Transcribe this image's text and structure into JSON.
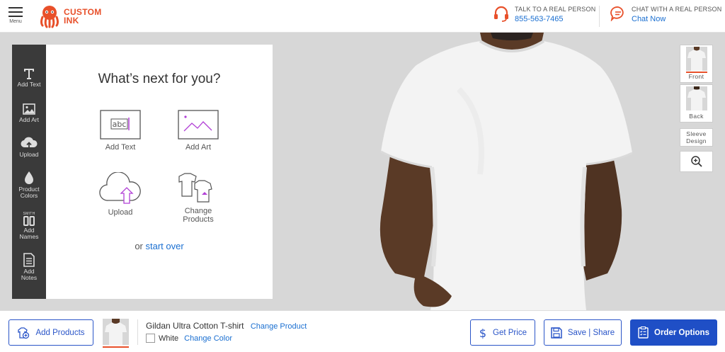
{
  "header": {
    "menu_label": "Menu",
    "logo_line1": "CUSTOM",
    "logo_line2": "INK",
    "phone": {
      "label": "TALK TO A REAL PERSON",
      "number": "855-563-7465",
      "icon": "headset-icon"
    },
    "chat": {
      "label": "CHAT WITH A REAL PERSON",
      "link": "Chat Now",
      "icon": "chat-bubble-icon"
    }
  },
  "toolbar": {
    "items": [
      {
        "label": "Add Text",
        "icon": "text-icon"
      },
      {
        "label": "Add Art",
        "icon": "image-icon"
      },
      {
        "label": "Upload",
        "icon": "cloud-upload-icon"
      },
      {
        "label_line1": "Product",
        "label_line2": "Colors",
        "icon": "droplet-icon"
      },
      {
        "label_line1": "Add",
        "label_line2": "Names",
        "icon": "names-icon",
        "icon_text": "SMITH"
      },
      {
        "label_line1": "Add",
        "label_line2": "Notes",
        "icon": "notes-icon"
      }
    ]
  },
  "panel": {
    "title": "What’s next for you?",
    "options": [
      {
        "label": "Add Text",
        "icon": "add-text-icon",
        "icon_text": "abc"
      },
      {
        "label": "Add Art",
        "icon": "add-art-icon"
      },
      {
        "label": "Upload",
        "icon": "upload-cloud-icon"
      },
      {
        "label_line1": "Change",
        "label_line2": "Products",
        "icon": "change-products-icon"
      }
    ],
    "start_over_prefix": "or",
    "start_over_link": "start over"
  },
  "views": {
    "front": "Front",
    "back": "Back",
    "sleeve_line1": "Sleeve",
    "sleeve_line2": "Design",
    "selected": "Front",
    "zoom_icon": "zoom-in-icon"
  },
  "bottom": {
    "add_products": "Add Products",
    "product_name": "Gildan Ultra Cotton T-shirt",
    "change_product": "Change Product",
    "color_name": "White",
    "change_color": "Change Color",
    "get_price": "Get Price",
    "save_share": "Save | Share",
    "order_options": "Order Options"
  },
  "colors": {
    "brand_orange": "#e8502a",
    "link_blue": "#1a6fd1",
    "button_blue": "#1f4fc6",
    "toolbar_dark": "#3a3a3a",
    "canvas_gray": "#d7d7d7",
    "icon_purple": "#b13fd6"
  }
}
